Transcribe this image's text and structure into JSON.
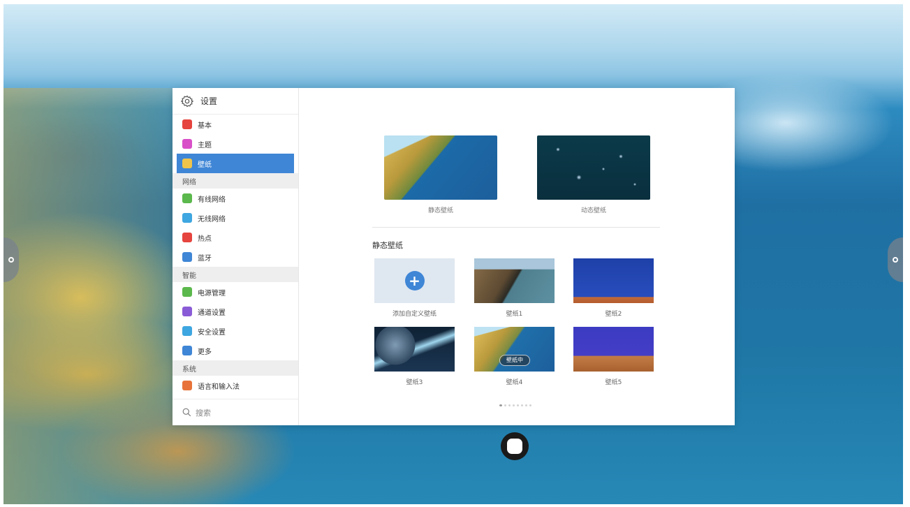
{
  "settings": {
    "title": "设置",
    "search_placeholder": "搜索"
  },
  "nav": {
    "items_top": [
      {
        "label": "基本",
        "icon": "basic-icon",
        "color": "#e6443e"
      },
      {
        "label": "主题",
        "icon": "theme-icon",
        "color": "#d84fc8"
      },
      {
        "label": "壁纸",
        "icon": "wallpaper-icon",
        "color": "#f0c44a",
        "active": true
      }
    ],
    "section_network": "网络",
    "items_network": [
      {
        "label": "有线网络",
        "icon": "wired-network-icon",
        "color": "#5bb84c"
      },
      {
        "label": "无线网络",
        "icon": "wifi-icon",
        "color": "#3ea6e0"
      },
      {
        "label": "热点",
        "icon": "hotspot-icon",
        "color": "#e6443e"
      },
      {
        "label": "蓝牙",
        "icon": "bluetooth-icon",
        "color": "#3f86d6"
      }
    ],
    "section_smart": "智能",
    "items_smart": [
      {
        "label": "电源管理",
        "icon": "power-icon",
        "color": "#5bb84c"
      },
      {
        "label": "通道设置",
        "icon": "channel-icon",
        "color": "#8a5bd6"
      },
      {
        "label": "安全设置",
        "icon": "security-shield-icon",
        "color": "#3ea6e0"
      },
      {
        "label": "更多",
        "icon": "more-icon",
        "color": "#3f86d6"
      }
    ],
    "section_system": "系统",
    "items_system": [
      {
        "label": "语言和输入法",
        "icon": "language-icon",
        "color": "#e8733a"
      }
    ]
  },
  "main": {
    "top_cards": [
      {
        "label": "静态壁纸"
      },
      {
        "label": "动态壁纸"
      }
    ],
    "section_title": "静态壁纸",
    "add_label": "添加自定义壁纸",
    "wallpapers": [
      {
        "label": "壁纸1"
      },
      {
        "label": "壁纸2"
      },
      {
        "label": "壁纸3"
      },
      {
        "label": "壁纸4",
        "badge": "壁纸中"
      },
      {
        "label": "壁纸5"
      }
    ],
    "pager": {
      "total": 8,
      "current": 1
    }
  },
  "colors": {
    "accent": "#3f86d6",
    "section_bg": "#eeeeee"
  }
}
